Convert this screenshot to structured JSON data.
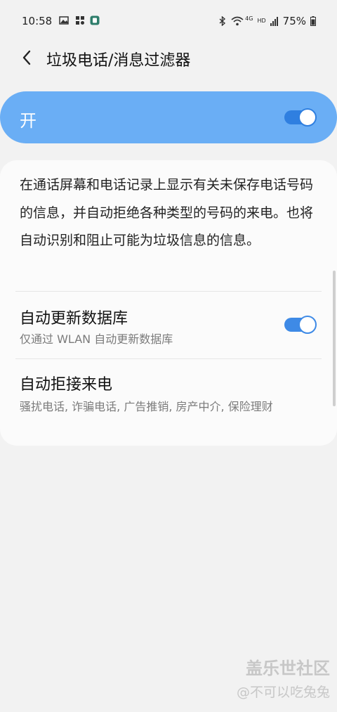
{
  "status_bar": {
    "time": "10:58",
    "battery_percent": "75%",
    "network_labels": [
      "4G",
      "HD",
      "4G"
    ],
    "icons": [
      "gallery-icon",
      "settings-app-icon",
      "notification-app-icon",
      "bluetooth-icon",
      "wifi-icon",
      "signal-icon",
      "signal-icon",
      "battery-icon"
    ]
  },
  "header": {
    "title": "垃圾电话/消息过滤器",
    "back_icon": "chevron-left-icon"
  },
  "master_switch": {
    "label": "开",
    "state": true
  },
  "description": "在通话屏幕和电话记录上显示有关未保存电话号码的信息，并自动拒绝各种类型的号码的来电。也将自动识别和阻止可能为垃圾信息的信息。",
  "settings": {
    "auto_update": {
      "title": "自动更新数据库",
      "subtitle": "仅通过 WLAN 自动更新数据库",
      "state": true
    },
    "auto_reject": {
      "title": "自动拒接来电",
      "subtitle": "骚扰电话, 诈骗电话, 广告推销, 房产中介, 保险理财"
    }
  },
  "watermark": {
    "main": "盖乐世社区",
    "sub": "@不可以吃兔兔"
  },
  "colors": {
    "accent": "#3e8ae6",
    "master_card": "#6aaef5",
    "background": "#f2f2f2"
  }
}
